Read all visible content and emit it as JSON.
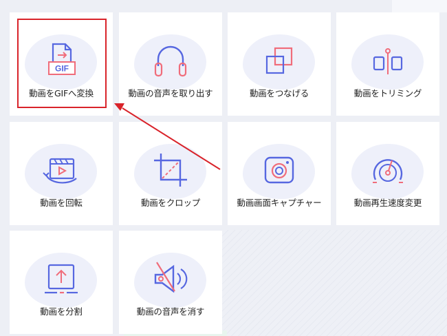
{
  "tools": [
    {
      "label": "動画をGIFへ変換",
      "icon": "gif-convert-icon"
    },
    {
      "label": "動画の音声を取り出す",
      "icon": "headphones-icon"
    },
    {
      "label": "動画をつなげる",
      "icon": "merge-icon"
    },
    {
      "label": "動画をトリミング",
      "icon": "trim-icon"
    },
    {
      "label": "動画を回転",
      "icon": "rotate-icon"
    },
    {
      "label": "動画をクロップ",
      "icon": "crop-icon"
    },
    {
      "label": "動画画面キャプチャー",
      "icon": "camera-icon"
    },
    {
      "label": "動画再生速度変更",
      "icon": "speed-icon"
    },
    {
      "label": "動画を分割",
      "icon": "split-icon"
    },
    {
      "label": "動画の音声を消す",
      "icon": "mute-icon"
    }
  ],
  "gif_badge": "GIF",
  "colors": {
    "blue": "#5667e0",
    "pink": "#f06c7a",
    "highlight": "#d9232a"
  }
}
